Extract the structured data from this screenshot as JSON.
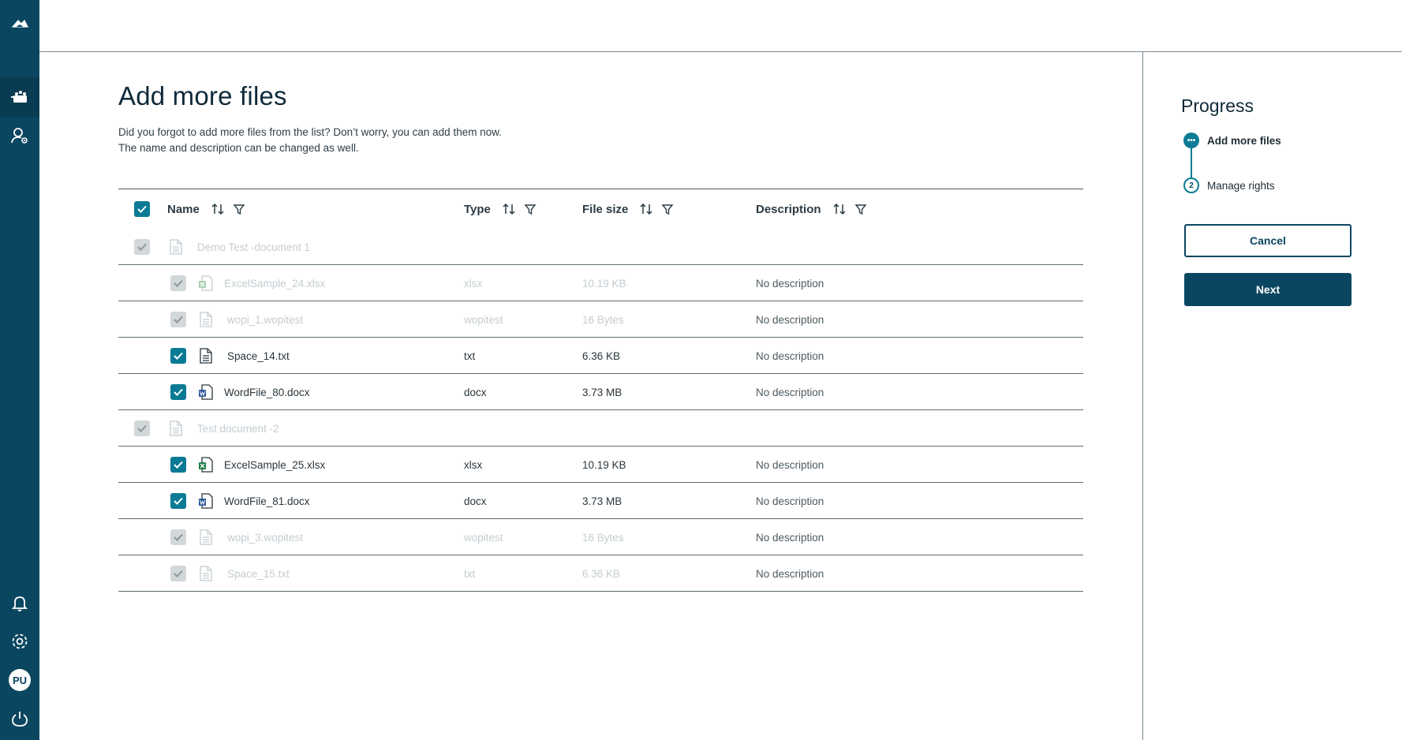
{
  "sidebar": {
    "items": [
      {
        "icon": "cloud-logo-icon"
      },
      {
        "icon": "files-icon",
        "active": true
      },
      {
        "icon": "user-settings-icon"
      },
      {
        "icon": "bell-icon"
      },
      {
        "icon": "gear-icon"
      },
      {
        "icon": "avatar",
        "label": "PU"
      },
      {
        "icon": "power-icon"
      }
    ]
  },
  "page": {
    "title": "Add more files",
    "desc_line1": "Did you forgot to add more files from the list? Don’t worry, you can add them now.",
    "desc_line2": "The name and description can be changed as well."
  },
  "table": {
    "columns": {
      "name": "Name",
      "type": "Type",
      "size": "File size",
      "description": "Description"
    },
    "rows": [
      {
        "kind": "group",
        "name": "Demo Test -document 1",
        "enabled": false
      },
      {
        "kind": "file",
        "name": "ExcelSample_24.xlsx",
        "icon": "excel",
        "type": "xlsx",
        "size": "10.19 KB",
        "description": "No description",
        "enabled": false
      },
      {
        "kind": "file",
        "name": "wopi_1.wopitest",
        "icon": "doc",
        "type": "wopitest",
        "size": "16 Bytes",
        "description": "No description",
        "enabled": false
      },
      {
        "kind": "file",
        "name": "Space_14.txt",
        "icon": "doc",
        "type": "txt",
        "size": "6.36 KB",
        "description": "No description",
        "enabled": true
      },
      {
        "kind": "file",
        "name": "WordFile_80.docx",
        "icon": "word",
        "type": "docx",
        "size": "3.73 MB",
        "description": "No description",
        "enabled": true
      },
      {
        "kind": "group",
        "name": "Test document -2",
        "enabled": false
      },
      {
        "kind": "file",
        "name": "ExcelSample_25.xlsx",
        "icon": "excel",
        "type": "xlsx",
        "size": "10.19 KB",
        "description": "No description",
        "enabled": true
      },
      {
        "kind": "file",
        "name": "WordFile_81.docx",
        "icon": "word",
        "type": "docx",
        "size": "3.73 MB",
        "description": "No description",
        "enabled": true
      },
      {
        "kind": "file",
        "name": "wopi_3.wopitest",
        "icon": "doc",
        "type": "wopitest",
        "size": "16 Bytes",
        "description": "No description",
        "enabled": false
      },
      {
        "kind": "file",
        "name": "Space_15.txt",
        "icon": "doc",
        "type": "txt",
        "size": "6.36 KB",
        "description": "No description",
        "enabled": false
      }
    ]
  },
  "progress": {
    "title": "Progress",
    "steps": [
      {
        "label": "Add more files",
        "marker": "•••",
        "state": "current"
      },
      {
        "label": "Manage rights",
        "marker": "2",
        "state": "todo"
      }
    ],
    "cancel_label": "Cancel",
    "next_label": "Next"
  },
  "colors": {
    "sidebar": "#0b4660",
    "accent": "#0b7b95",
    "primary_button": "#0b4660"
  }
}
